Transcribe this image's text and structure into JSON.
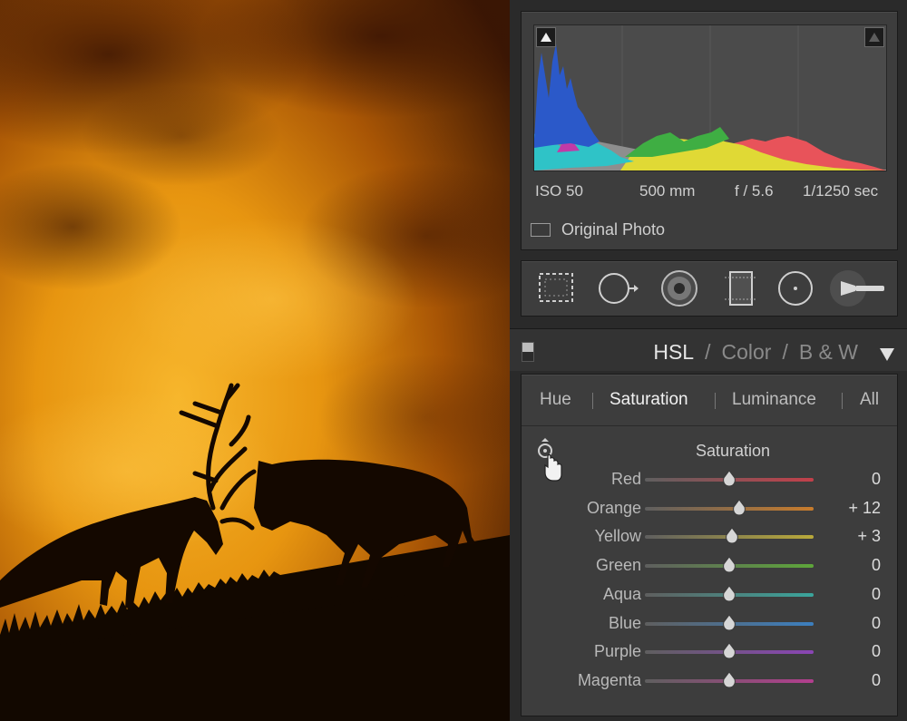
{
  "histogram": {
    "iso": "ISO 50",
    "focal": "500 mm",
    "aperture": "f / 5.6",
    "shutter": "1/1250 sec",
    "original_photo_label": "Original Photo"
  },
  "tools": [
    {
      "name": "crop-overlay-icon"
    },
    {
      "name": "spot-removal-icon"
    },
    {
      "name": "red-eye-icon"
    },
    {
      "name": "graduated-filter-icon"
    },
    {
      "name": "radial-filter-icon"
    },
    {
      "name": "adjustment-brush-icon"
    }
  ],
  "hsl_header": {
    "hsl": "HSL",
    "slash": "/",
    "color": "Color",
    "bw": "B & W"
  },
  "tabs": {
    "hue": "Hue",
    "saturation": "Saturation",
    "luminance": "Luminance",
    "all": "All",
    "active": "saturation"
  },
  "saturation": {
    "heading": "Saturation",
    "sliders": [
      {
        "label": "Red",
        "value": "0",
        "num": 0,
        "color": "#c2404a"
      },
      {
        "label": "Orange",
        "value": "+ 12",
        "num": 12,
        "color": "#c87c2c"
      },
      {
        "label": "Yellow",
        "value": "+ 3",
        "num": 3,
        "color": "#b9a93a"
      },
      {
        "label": "Green",
        "value": "0",
        "num": 0,
        "color": "#5ea63a"
      },
      {
        "label": "Aqua",
        "value": "0",
        "num": 0,
        "color": "#3aa59c"
      },
      {
        "label": "Blue",
        "value": "0",
        "num": 0,
        "color": "#3c7fbf"
      },
      {
        "label": "Purple",
        "value": "0",
        "num": 0,
        "color": "#8a45b5"
      },
      {
        "label": "Magenta",
        "value": "0",
        "num": 0,
        "color": "#b33e8e"
      }
    ]
  }
}
